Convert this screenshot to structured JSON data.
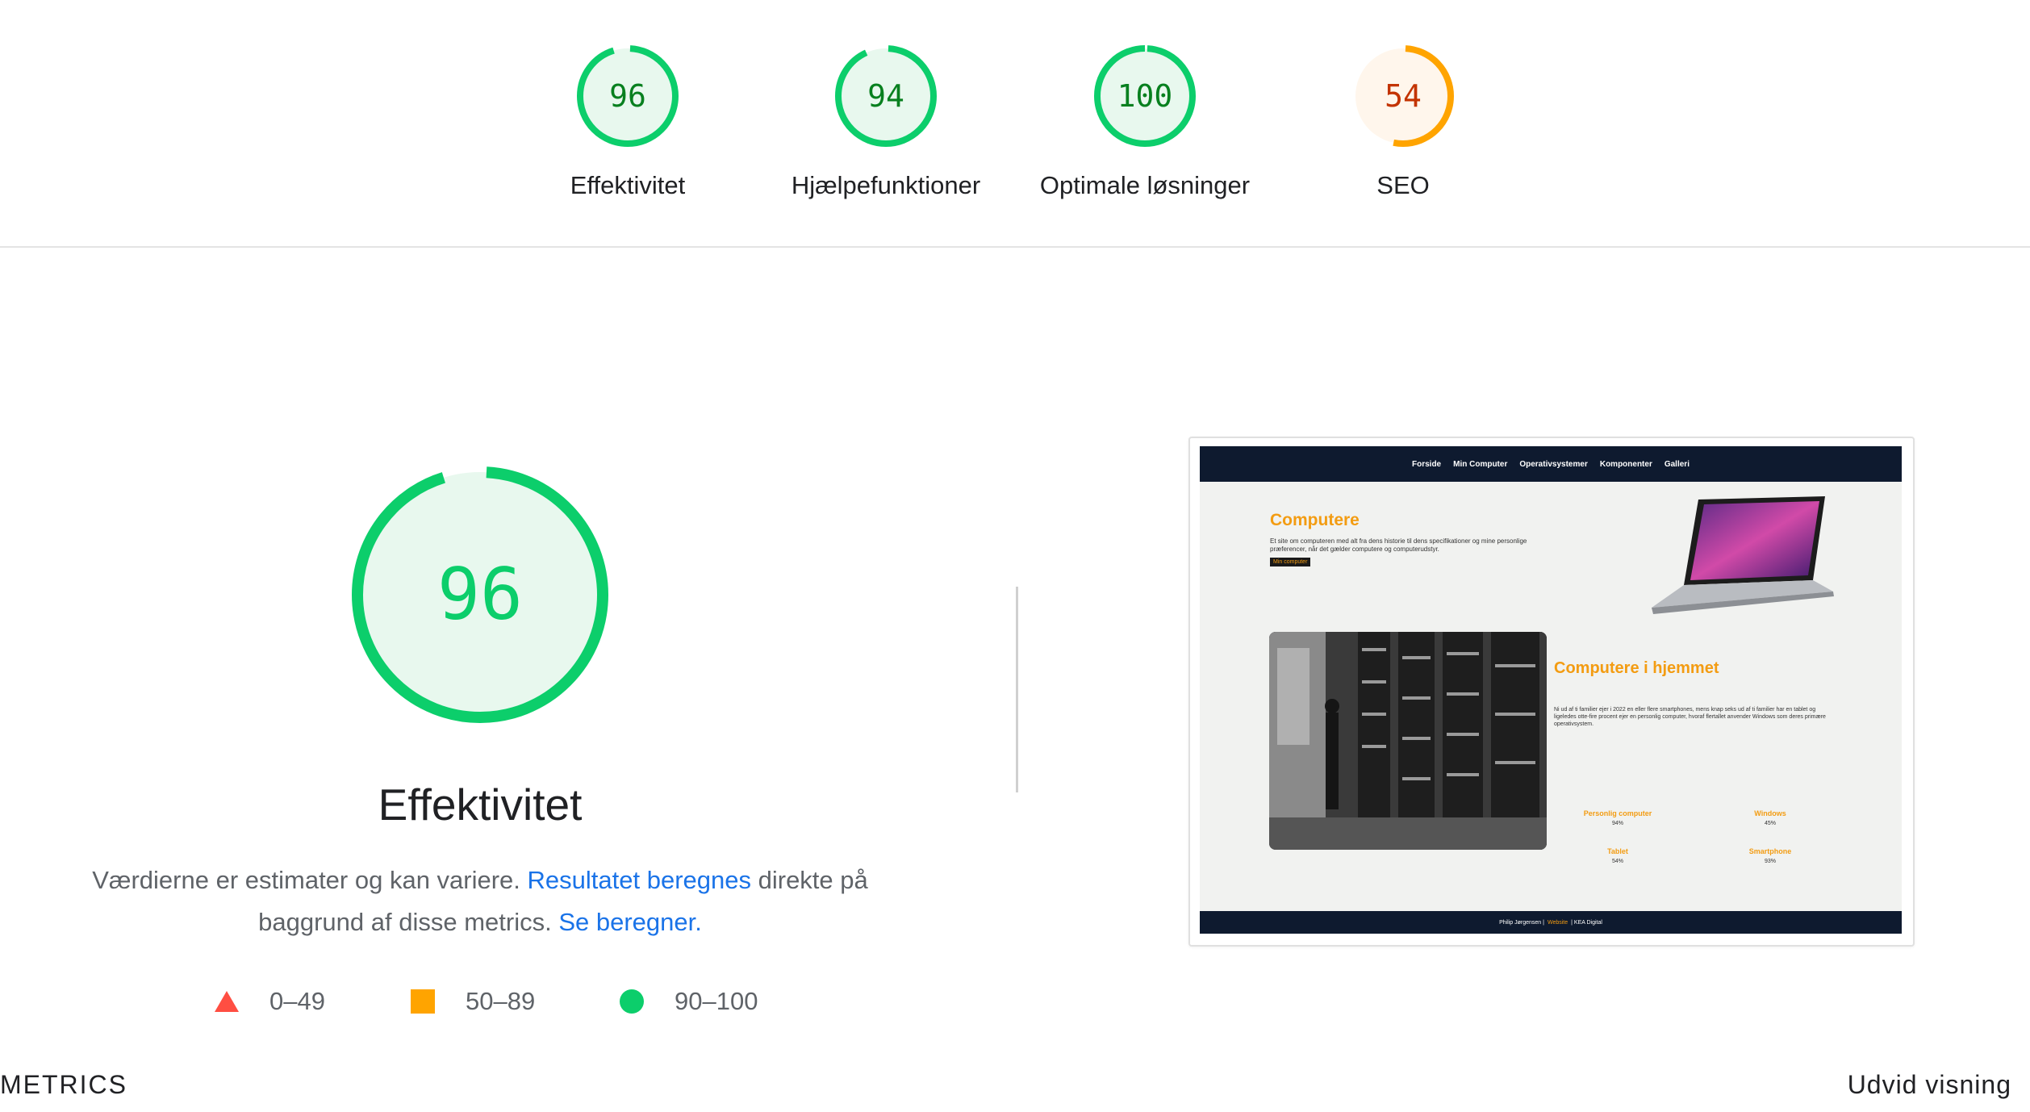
{
  "top_scores": [
    {
      "score": "96",
      "label": "Effektivitet",
      "fraction": 0.96,
      "status": "pass"
    },
    {
      "score": "94",
      "label": "Hjælpefunktioner",
      "fraction": 0.94,
      "status": "pass"
    },
    {
      "score": "100",
      "label": "Optimale løsninger",
      "fraction": 1.0,
      "status": "pass"
    },
    {
      "score": "54",
      "label": "SEO",
      "fraction": 0.54,
      "status": "average"
    }
  ],
  "colors": {
    "pass": "#0cce6b",
    "pass_text": "#08801f",
    "pass_bg": "#e8f8ee",
    "average": "#ffa400",
    "average_text": "#c33300",
    "average_bg": "#fff6ec",
    "fail": "#ff4e42",
    "link": "#1a73e8"
  },
  "main": {
    "score": "96",
    "fraction": 0.96,
    "title": "Effektivitet",
    "desc_prefix": "Værdierne er estimater og kan variere. ",
    "desc_link1": "Resultatet beregnes",
    "desc_mid": " direkte på baggrund af disse metrics. ",
    "desc_link2": "Se beregner."
  },
  "legend": [
    {
      "icon": "triangle-icon",
      "range": "0–49"
    },
    {
      "icon": "square-icon",
      "range": "50–89"
    },
    {
      "icon": "circle-icon",
      "range": "90–100"
    }
  ],
  "preview": {
    "nav": [
      "Forside",
      "Min Computer",
      "Operativsystemer",
      "Komponenter",
      "Galleri"
    ],
    "heading": "Computere",
    "intro": "Et site om computeren med alt fra dens historie til dens specifikationer og mine personlige præferencer, når det gælder computere og computerudstyr.",
    "button": "Min computer",
    "heading2": "Computere i hjemmet",
    "paragraph": "Ni ud af ti familier ejer i 2022 en eller flere smartphones, mens knap seks ud af ti familier har en tablet og ligeledes otte-fire procent ejer en personlig computer, hvoraf flertallet anvender Windows som deres primære operativsystem.",
    "stats": [
      {
        "label": "Personlig computer",
        "value": "94%"
      },
      {
        "label": "Windows",
        "value": "45%"
      },
      {
        "label": "Tablet",
        "value": "54%"
      },
      {
        "label": "Smartphone",
        "value": "93%"
      }
    ],
    "footer_left": "Philip Jørgensen |",
    "footer_link": "Website",
    "footer_right": "| KEA Digital"
  },
  "bottom": {
    "left": "METRICS",
    "right": "Udvid visning"
  }
}
